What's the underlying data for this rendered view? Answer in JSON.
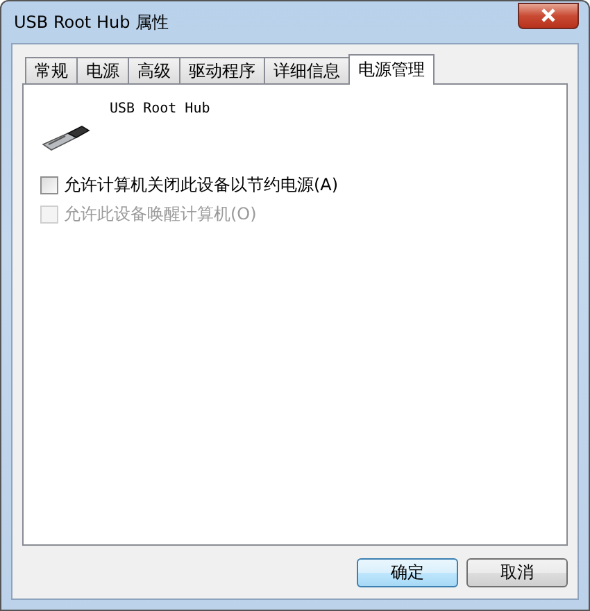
{
  "window": {
    "title": "USB Root Hub 属性"
  },
  "tabs": [
    {
      "label": "常规",
      "selected": false
    },
    {
      "label": "电源",
      "selected": false
    },
    {
      "label": "高级",
      "selected": false
    },
    {
      "label": "驱动程序",
      "selected": false
    },
    {
      "label": "详细信息",
      "selected": false
    },
    {
      "label": "电源管理",
      "selected": true
    }
  ],
  "device": {
    "name": "USB Root Hub"
  },
  "options": [
    {
      "label": "允许计算机关闭此设备以节约电源(A)",
      "checked": false,
      "disabled": false
    },
    {
      "label": "允许此设备唤醒计算机(O)",
      "checked": false,
      "disabled": true
    }
  ],
  "buttons": [
    "确定",
    "取消"
  ]
}
